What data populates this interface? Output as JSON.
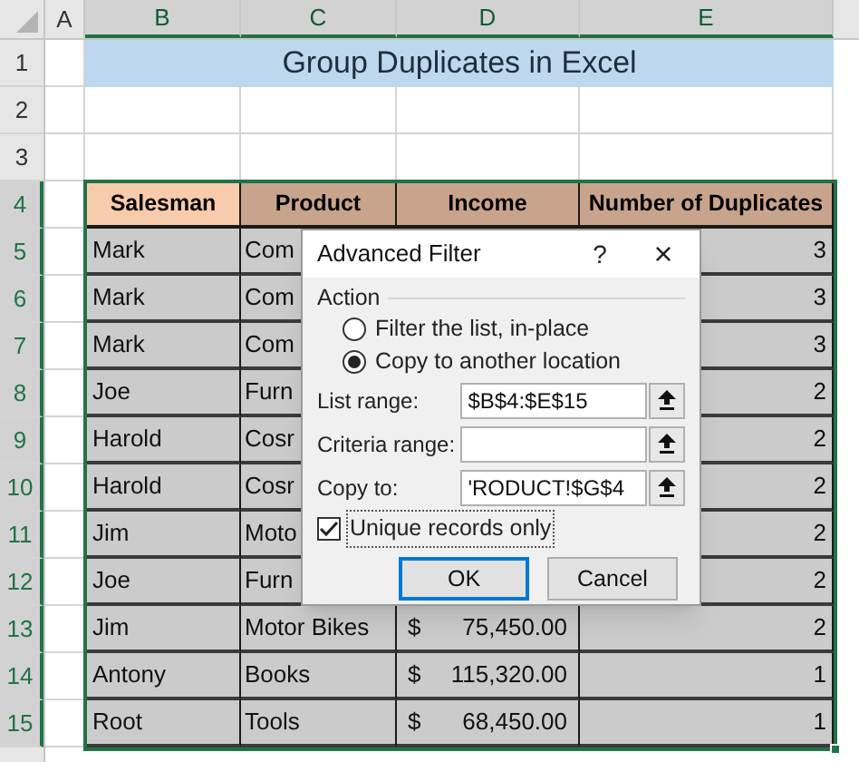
{
  "sheet": {
    "column_headers": [
      {
        "label": "A",
        "selected": false
      },
      {
        "label": "B",
        "selected": true
      },
      {
        "label": "C",
        "selected": true
      },
      {
        "label": "D",
        "selected": true
      },
      {
        "label": "E",
        "selected": true
      }
    ],
    "row_headers": [
      {
        "label": "1",
        "selected": false
      },
      {
        "label": "2",
        "selected": false
      },
      {
        "label": "3",
        "selected": false
      },
      {
        "label": "4",
        "selected": true
      },
      {
        "label": "5",
        "selected": true
      },
      {
        "label": "6",
        "selected": true
      },
      {
        "label": "7",
        "selected": true
      },
      {
        "label": "8",
        "selected": true
      },
      {
        "label": "9",
        "selected": true
      },
      {
        "label": "10",
        "selected": true
      },
      {
        "label": "11",
        "selected": true
      },
      {
        "label": "12",
        "selected": true
      },
      {
        "label": "13",
        "selected": true
      },
      {
        "label": "14",
        "selected": true
      },
      {
        "label": "15",
        "selected": true
      }
    ],
    "title": "Group Duplicates in Excel",
    "table": {
      "columns": [
        "Salesman",
        "Product",
        "Income",
        "Number of Duplicates"
      ],
      "rows": [
        {
          "salesman": "Mark",
          "product": "Com",
          "duplicates": "3"
        },
        {
          "salesman": "Mark",
          "product": "Com",
          "duplicates": "3"
        },
        {
          "salesman": "Mark",
          "product": "Com",
          "duplicates": "3"
        },
        {
          "salesman": "Joe",
          "product": "Furn",
          "duplicates": "2"
        },
        {
          "salesman": "Harold",
          "product": "Cosr",
          "duplicates": "2"
        },
        {
          "salesman": "Harold",
          "product": "Cosr",
          "duplicates": "2"
        },
        {
          "salesman": "Jim",
          "product": "Moto",
          "duplicates": "2"
        },
        {
          "salesman": "Joe",
          "product": "Furn",
          "duplicates": "2"
        },
        {
          "salesman": "Jim",
          "product": "Motor Bikes",
          "currency": "$",
          "income": "75,450.00",
          "duplicates": "2"
        },
        {
          "salesman": "Antony",
          "product": "Books",
          "currency": "$",
          "income": "115,320.00",
          "duplicates": "1"
        },
        {
          "salesman": "Root",
          "product": "Tools",
          "currency": "$",
          "income": "68,450.00",
          "duplicates": "1"
        }
      ]
    }
  },
  "dialog": {
    "title": "Advanced Filter",
    "help": "?",
    "close": "×",
    "group": "Action",
    "options": [
      {
        "label": "Filter the list, in-place",
        "selected": false
      },
      {
        "label": "Copy to another location",
        "selected": true
      }
    ],
    "fields": [
      {
        "label": "List range:",
        "value": "$B$4:$E$15"
      },
      {
        "label": "Criteria range:"
      },
      {
        "label": "Copy to:",
        "value": "'RODUCT!$G$4"
      }
    ],
    "unique": {
      "label": "Unique records only",
      "checked": true
    },
    "buttons": [
      {
        "label": "OK",
        "default": true
      },
      {
        "label": "Cancel",
        "default": false
      }
    ]
  }
}
